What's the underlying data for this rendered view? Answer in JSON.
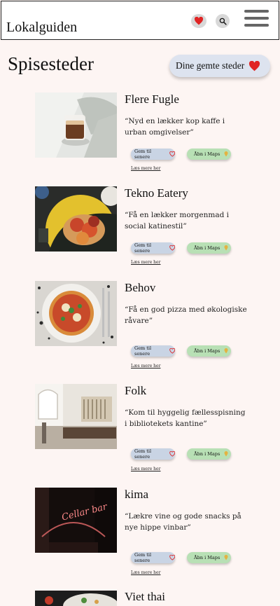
{
  "header": {
    "brand": "Lokalguiden",
    "icons": [
      "heart-icon",
      "search-icon",
      "hamburger-menu-icon"
    ]
  },
  "page": {
    "title": "Spisesteder",
    "saved_button_label": "Dine gemte steder"
  },
  "colors": {
    "accent_red": "#e02424",
    "save_pill": "#c9d4e4",
    "map_pill": "#b8e0b5",
    "background": "#fdf5f3"
  },
  "places": [
    {
      "name": "Flere Fugle",
      "description": "“Nyd en lækker kop kaffe i urban omgivelser”",
      "save_label": "Gem til senere",
      "map_label": "Åbn i Maps",
      "more_label": "Læs mere her"
    },
    {
      "name": "Tekno Eatery",
      "description": "“Få en lækker morgenmad i social katinestil”",
      "save_label": "Gem til senere",
      "map_label": "Åbn i Maps",
      "more_label": "Læs mere her"
    },
    {
      "name": "Behov",
      "description": "“Få en god pizza med økologiske råvare”",
      "save_label": "Gem til senere",
      "map_label": "Åbn i Maps",
      "more_label": "Læs mere her"
    },
    {
      "name": "Folk",
      "description": "“Kom til hyggelig fællesspisning i bibliotekets kantine”",
      "save_label": "Gem til senere",
      "map_label": "Åbn i Maps",
      "more_label": "Læs mere her"
    },
    {
      "name": "kima",
      "description": "“Lækre vine og gode snacks på nye hippe vinbar”",
      "save_label": "Gem til senere",
      "map_label": "Åbn i Maps",
      "more_label": "Læs mere her"
    },
    {
      "name": "Viet thai",
      "description": "",
      "save_label": "",
      "map_label": "",
      "more_label": ""
    }
  ],
  "photo_text": {
    "kima": "Cellar bar"
  }
}
